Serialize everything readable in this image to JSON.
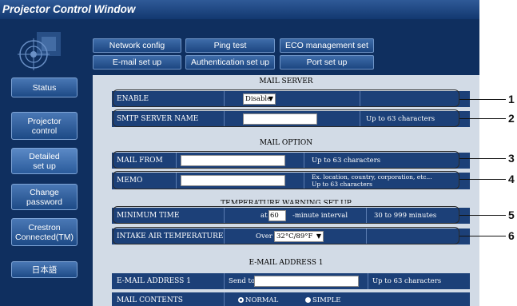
{
  "window": {
    "title": "Projector Control Window"
  },
  "sidebar": {
    "items": [
      {
        "label": "Status"
      },
      {
        "label": "Projector\ncontrol"
      },
      {
        "label": "Detailed\nset up"
      },
      {
        "label": "Change\npassword"
      },
      {
        "label": "Crestron\nConnected(TM)"
      },
      {
        "label": "日本語"
      }
    ]
  },
  "tabs": {
    "row1": [
      "Network config",
      "Ping test",
      "ECO management set up"
    ],
    "row2": [
      "E-mail set up",
      "Authentication set up",
      "Port set up"
    ]
  },
  "mail_server": {
    "title": "MAIL SERVER",
    "enable_label": "ENABLE",
    "enable_value": "Disable",
    "smtp_label": "SMTP SERVER NAME",
    "smtp_value": "",
    "smtp_hint": "Up to 63 characters"
  },
  "mail_option": {
    "title": "MAIL OPTION",
    "from_label": "MAIL FROM",
    "from_value": "",
    "from_hint": "Up to 63 characters",
    "memo_label": "MEMO",
    "memo_value": "",
    "memo_hint_1": "Ex. location, country, corporation, etc...",
    "memo_hint_2": "Up to 63 characters"
  },
  "temperature": {
    "title": "TEMPERATURE WARNING SET UP",
    "min_time_label": "MINIMUM TIME",
    "min_time_prefix": "at",
    "min_time_value": "60",
    "min_time_suffix": "-minute interval",
    "min_time_hint": "30 to 999 minutes",
    "intake_label": "INTAKE AIR TEMPERATURE",
    "intake_prefix": "Over",
    "intake_value": "32°C/89°F"
  },
  "email1": {
    "title": "E-MAIL ADDRESS 1",
    "addr_label": "E-MAIL ADDRESS 1",
    "addr_prefix": "Send to",
    "addr_value": "",
    "addr_hint": "Up to 63 characters",
    "contents_label": "MAIL CONTENTS",
    "contents_options": [
      "NORMAL",
      "SIMPLE"
    ],
    "contents_selected": "NORMAL"
  },
  "callouts": [
    "1",
    "2",
    "3",
    "4",
    "5",
    "6"
  ]
}
